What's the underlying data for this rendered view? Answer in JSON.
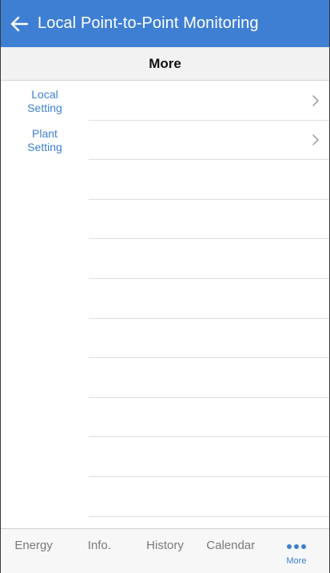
{
  "header": {
    "title": "Local Point-to-Point Monitoring",
    "back_icon": "arrow-left-icon"
  },
  "subheader": {
    "title": "More"
  },
  "list": {
    "items": [
      {
        "label_line1": "Local",
        "label_line2": "Setting",
        "has_chevron": true
      },
      {
        "label_line1": "Plant",
        "label_line2": "Setting",
        "has_chevron": true
      }
    ],
    "empty_rows": 9
  },
  "tabs": [
    {
      "label": "Energy",
      "active": false
    },
    {
      "label": "Info.",
      "active": false
    },
    {
      "label": "History",
      "active": false
    },
    {
      "label": "Calendar",
      "active": false
    },
    {
      "label": "More",
      "active": true,
      "icon": "more-dots-icon"
    }
  ],
  "colors": {
    "accent": "#3f7fd3",
    "inactive_tab": "#7a7a7a",
    "separator": "#dddddd"
  }
}
